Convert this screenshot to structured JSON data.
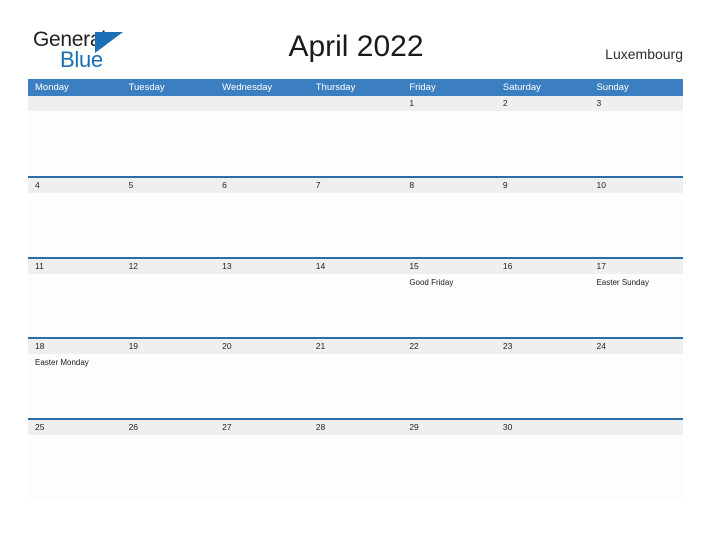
{
  "brand": {
    "name_part1": "General",
    "name_part2": "Blue",
    "triangle_color": "#1c6fb4",
    "text_color": "#231f20"
  },
  "header": {
    "title": "April 2022",
    "country": "Luxembourg"
  },
  "theme": {
    "header_blue": "#3c7fc0",
    "rule_blue": "#2e6da4",
    "date_band_gray": "#efefef",
    "page_background": "#ffffff"
  },
  "calendar": {
    "weekday_headers": [
      "Monday",
      "Tuesday",
      "Wednesday",
      "Thursday",
      "Friday",
      "Saturday",
      "Sunday"
    ],
    "weeks": [
      [
        {
          "date": "",
          "events": []
        },
        {
          "date": "",
          "events": []
        },
        {
          "date": "",
          "events": []
        },
        {
          "date": "",
          "events": []
        },
        {
          "date": "1",
          "events": []
        },
        {
          "date": "2",
          "events": []
        },
        {
          "date": "3",
          "events": []
        }
      ],
      [
        {
          "date": "4",
          "events": []
        },
        {
          "date": "5",
          "events": []
        },
        {
          "date": "6",
          "events": []
        },
        {
          "date": "7",
          "events": []
        },
        {
          "date": "8",
          "events": []
        },
        {
          "date": "9",
          "events": []
        },
        {
          "date": "10",
          "events": []
        }
      ],
      [
        {
          "date": "11",
          "events": []
        },
        {
          "date": "12",
          "events": []
        },
        {
          "date": "13",
          "events": []
        },
        {
          "date": "14",
          "events": []
        },
        {
          "date": "15",
          "events": [
            "Good Friday"
          ]
        },
        {
          "date": "16",
          "events": []
        },
        {
          "date": "17",
          "events": [
            "Easter Sunday"
          ]
        }
      ],
      [
        {
          "date": "18",
          "events": [
            "Easter Monday"
          ]
        },
        {
          "date": "19",
          "events": []
        },
        {
          "date": "20",
          "events": []
        },
        {
          "date": "21",
          "events": []
        },
        {
          "date": "22",
          "events": []
        },
        {
          "date": "23",
          "events": []
        },
        {
          "date": "24",
          "events": []
        }
      ],
      [
        {
          "date": "25",
          "events": []
        },
        {
          "date": "26",
          "events": []
        },
        {
          "date": "27",
          "events": []
        },
        {
          "date": "28",
          "events": []
        },
        {
          "date": "29",
          "events": []
        },
        {
          "date": "30",
          "events": []
        },
        {
          "date": "",
          "events": []
        }
      ]
    ]
  }
}
